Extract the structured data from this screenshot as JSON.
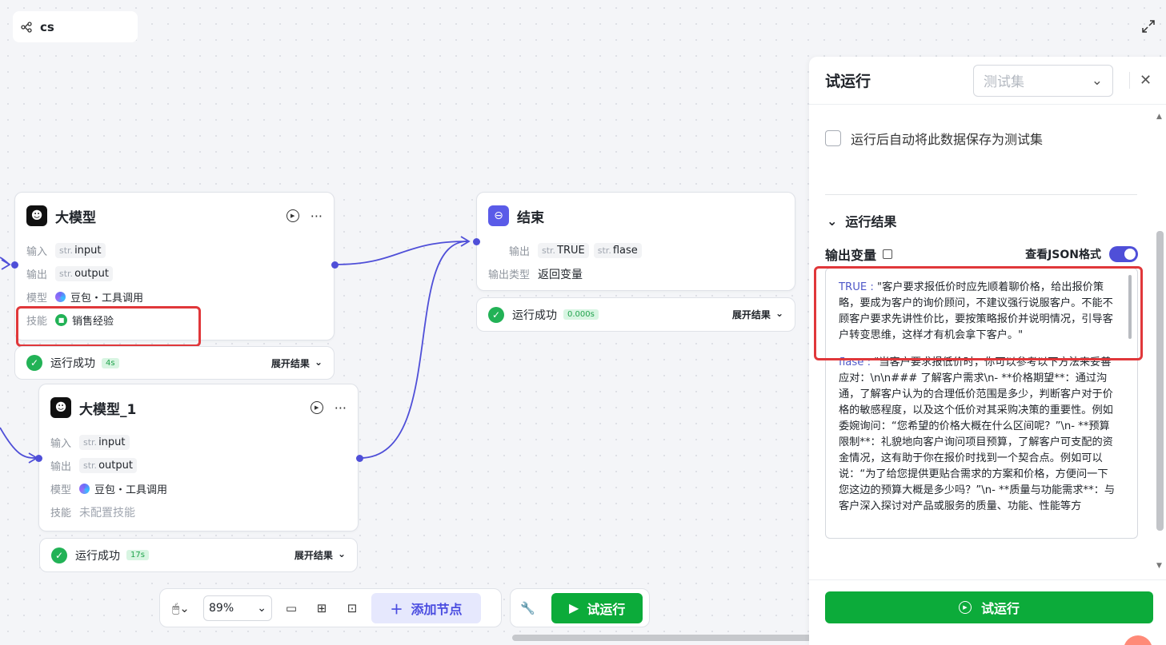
{
  "app": {
    "title": "cs"
  },
  "nodes": {
    "llm": {
      "title": "大模型",
      "input_label": "输入",
      "input_type": "str.",
      "input_name": "input",
      "output_label": "输出",
      "output_type": "str.",
      "output_name": "output",
      "model_label": "模型",
      "model_value": "豆包・工具调用",
      "skill_label": "技能",
      "skill_value": "销售经验",
      "status": "运行成功",
      "time": "4s",
      "expand": "展开结果"
    },
    "llm1": {
      "title": "大模型_1",
      "input_label": "输入",
      "input_type": "str.",
      "input_name": "input",
      "output_label": "输出",
      "output_type": "str.",
      "output_name": "output",
      "model_label": "模型",
      "model_value": "豆包・工具调用",
      "skill_label": "技能",
      "skill_value": "未配置技能",
      "status": "运行成功",
      "time": "17s",
      "expand": "展开结果"
    },
    "end": {
      "title": "结束",
      "output_label": "输出",
      "out1_type": "str.",
      "out1_name": "TRUE",
      "out2_type": "str.",
      "out2_name": "flase",
      "output_type_label": "输出类型",
      "output_type_value": "返回变量",
      "status": "运行成功",
      "time": "0.000s",
      "expand": "展开结果"
    }
  },
  "toolbar": {
    "zoom": "89%",
    "add_node": "添加节点",
    "test_run": "试运行"
  },
  "panel": {
    "title": "试运行",
    "testset_placeholder": "测试集",
    "save_checkbox_label": "运行后自动将此数据保存为测试集",
    "results_title": "运行结果",
    "output_vars_label": "输出变量",
    "json_toggle_label": "查看JSON格式",
    "json_toggle_on": true,
    "result_true_key": "TRUE :",
    "result_true_value": "\"客户要求报低价时应先顺着聊价格，给出报价策略，要成为客户的询价顾问，不建议强行说服客户。不能不顾客户要求先讲性价比，要按策略报价并说明情况，引导客户转变思维，这样才有机会拿下客户。\"",
    "result_flase_key": "flase :",
    "result_flase_value": "\"当客户要求报低价时，你可以参考以下方法来妥善应对：\\n\\n### 了解客户需求\\n- **价格期望**：通过沟通，了解客户认为的合理低价范围是多少，判断客户对于价格的敏感程度，以及这个低价对其采购决策的重要性。例如委婉询问：“您希望的价格大概在什么区间呢？”\\n- **预算限制**：礼貌地向客户询问项目预算，了解客户可支配的资金情况，这有助于你在报价时找到一个契合点。例如可以说：“为了给您提供更贴合需求的方案和价格，方便问一下您这边的预算大概是多少吗？”\\n- **质量与功能需求**：与客户深入探讨对产品或服务的质量、功能、性能等方",
    "run_button": "试运行"
  },
  "colors": {
    "accent": "#4f4fd8",
    "success": "#0cab3a",
    "highlight": "#e0373a"
  }
}
